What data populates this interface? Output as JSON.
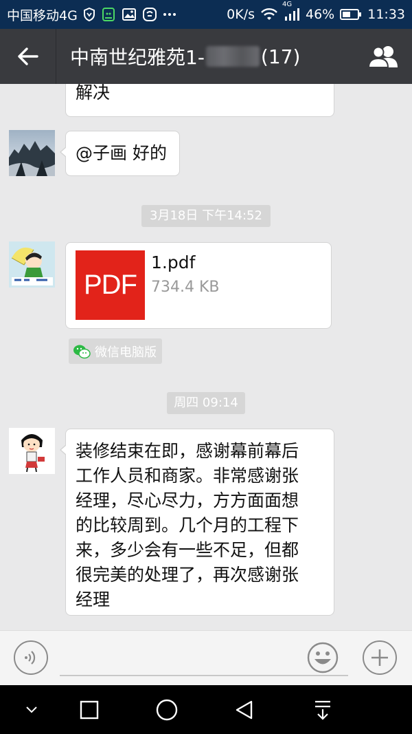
{
  "status_bar": {
    "carrier": "中国移动4G",
    "network_speed": "0K/s",
    "network_type": "4G",
    "battery_percent": "46%",
    "time": "11:33"
  },
  "header": {
    "title_prefix": "中南世纪雅苑1-",
    "title_suffix": "(17)"
  },
  "messages": [
    {
      "type": "text",
      "text": "解决"
    },
    {
      "type": "text",
      "text": "@子画 好的"
    },
    {
      "type": "timestamp",
      "text": "3月18日 下午14:52"
    },
    {
      "type": "file",
      "icon_label": "PDF",
      "file_name": "1.pdf",
      "file_size": "734.4 KB",
      "source": "微信电脑版"
    },
    {
      "type": "timestamp",
      "text": "周四 09:14"
    },
    {
      "type": "text",
      "lines": [
        "装修结束在即，感谢幕前幕后",
        "工作人员和商家。非常感谢张",
        "经理，尽心尽力，方方面面想",
        "的比较周到。几个月的工程下",
        "来，多少会有一些不足，但都",
        "很完美的处理了，再次感谢张",
        "经理"
      ]
    }
  ],
  "input_bar": {
    "placeholder": ""
  },
  "colors": {
    "status_bar_bg": "#0c2d53",
    "title_bar_bg": "#393a3e",
    "chat_bg": "#e9e9ea",
    "pdf_red": "#e2231a"
  }
}
